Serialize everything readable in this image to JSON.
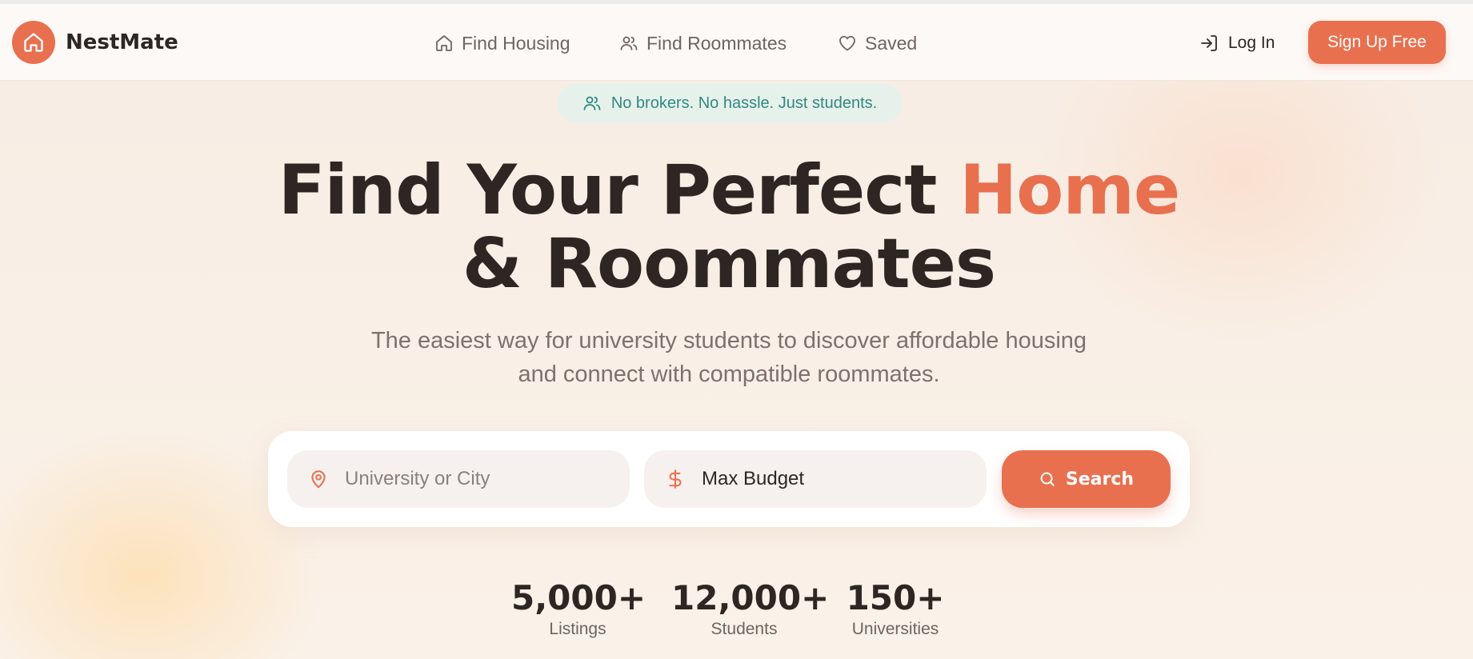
{
  "app": {
    "name": "NestMate",
    "logo_icon": "house-icon"
  },
  "nav": {
    "links": [
      {
        "label": "Find Housing",
        "icon": "home-icon"
      },
      {
        "label": "Find Roommates",
        "icon": "users-icon"
      },
      {
        "label": "Saved",
        "icon": "heart-icon"
      }
    ],
    "login_label": "Log In",
    "signup_label": "Sign Up Free"
  },
  "hero": {
    "badge": "No brokers. No hassle. Just students.",
    "headline_part1": "Find Your Perfect ",
    "headline_accent": "Home",
    "headline_part2": " & Roommates",
    "subtitle": "The easiest way for university students to discover affordable housing and connect with compatible roommates."
  },
  "search": {
    "location_placeholder": "University or City",
    "budget_placeholder": "Max Budget",
    "button_label": "Search"
  },
  "stats": [
    {
      "value": "5,000+",
      "label": "Listings"
    },
    {
      "value": "12,000+",
      "label": "Students"
    },
    {
      "value": "150+",
      "label": "Universities"
    }
  ],
  "colors": {
    "accent": "#e8704f",
    "text": "#2f2522",
    "muted": "#7c716d",
    "badge_bg": "#e7f1ec",
    "badge_text": "#2f8a7e"
  }
}
